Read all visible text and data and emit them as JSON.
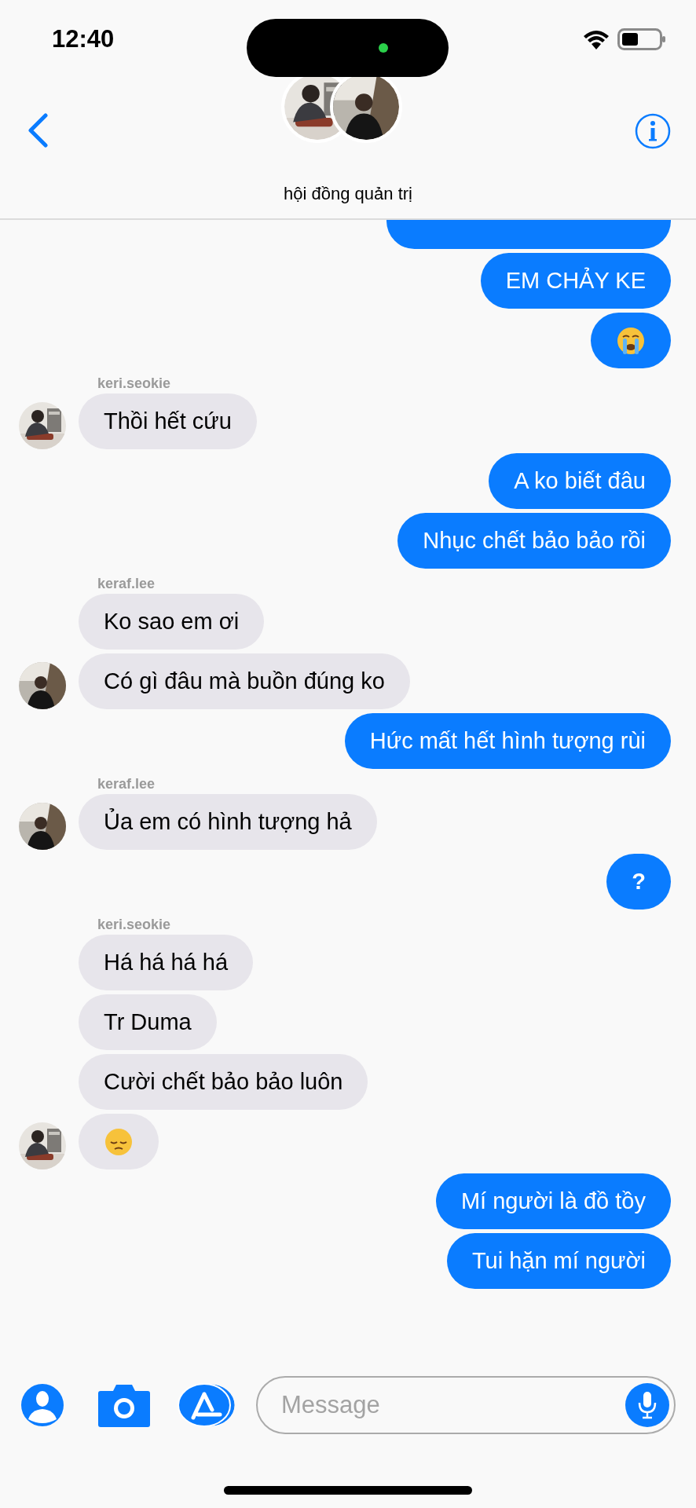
{
  "status_bar": {
    "time": "12:40"
  },
  "header": {
    "title": "hội đồng quản trị"
  },
  "groups": [
    {
      "kind": "sent",
      "messages": [
        {
          "kind": "clipped"
        },
        {
          "kind": "text",
          "text": "EM CHẢY KE"
        },
        {
          "kind": "crying_emoji"
        }
      ]
    },
    {
      "kind": "received",
      "sender": "keri.seokie",
      "messages": [
        {
          "kind": "text",
          "text": "Thồi hết cứu"
        }
      ]
    },
    {
      "kind": "sent",
      "messages": [
        {
          "kind": "text",
          "text": "A ko biết đâu"
        },
        {
          "kind": "text",
          "text": "Nhục chết bảo bảo rồi"
        }
      ]
    },
    {
      "kind": "received",
      "sender": "keraf.lee",
      "messages": [
        {
          "kind": "text",
          "text": "Ko sao em ơi"
        },
        {
          "kind": "text",
          "text": "Có gì đâu mà buồn đúng ko"
        }
      ]
    },
    {
      "kind": "sent",
      "messages": [
        {
          "kind": "text",
          "text": "Hức mất hết hình tượng rùi"
        }
      ]
    },
    {
      "kind": "received",
      "sender": "keraf.lee",
      "messages": [
        {
          "kind": "text",
          "text": "Ủa em có hình tượng hả"
        }
      ]
    },
    {
      "kind": "sent",
      "messages": [
        {
          "kind": "text",
          "text": "?"
        }
      ]
    },
    {
      "kind": "received",
      "sender": "keri.seokie",
      "messages": [
        {
          "kind": "text",
          "text": "Há há há há"
        },
        {
          "kind": "text",
          "text": "Tr Duma"
        },
        {
          "kind": "text",
          "text": "Cười chết bảo bảo luôn"
        },
        {
          "kind": "pensive_emoji"
        }
      ]
    },
    {
      "kind": "sent",
      "messages": [
        {
          "kind": "text",
          "text": "Mí người là đồ tồy"
        },
        {
          "kind": "text",
          "text": "Tui hặn mí người"
        }
      ]
    }
  ],
  "composer": {
    "placeholder": "Message"
  }
}
